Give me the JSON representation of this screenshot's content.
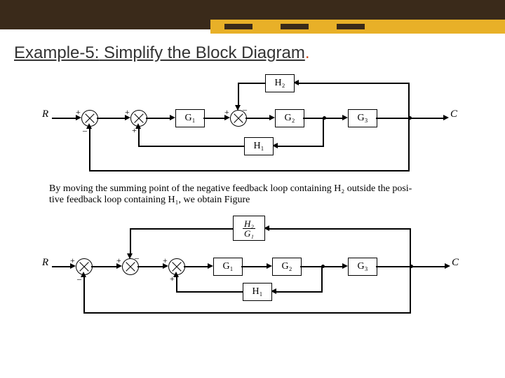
{
  "title_prefix": "Example-5:",
  "title_rest": " Simplify the Block Diagram",
  "title_punct": ".",
  "caption_line1": "By moving the summing point of the negative feedback loop containing H₂ outside the posi-",
  "caption_line2": "tive feedback loop containing H₁, we obtain Figure",
  "labels": {
    "R": "R",
    "C": "C",
    "G1": "G₁",
    "G2": "G₂",
    "G3": "G₃",
    "H1": "H₁",
    "H2": "H₂",
    "H2G1": "H₂ / G₁"
  },
  "signs": {
    "plus": "+",
    "minus": "–"
  }
}
